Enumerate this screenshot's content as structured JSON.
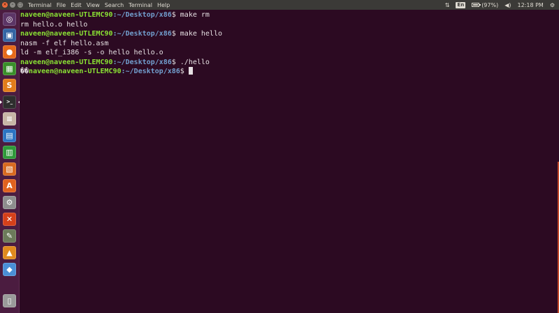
{
  "top_panel": {
    "menu": [
      "Terminal",
      "File",
      "Edit",
      "View",
      "Search",
      "Terminal",
      "Help"
    ],
    "network_icon": "network-updown-icon",
    "keyboard_layout": "En",
    "battery_percent": 97,
    "battery_text": "(97%)",
    "volume_icon": "speaker-icon",
    "clock": "12:18 PM",
    "power_icon": "gear-icon"
  },
  "launcher": {
    "items": [
      {
        "name": "dash",
        "glyph": "◎",
        "color": "#5c3566"
      },
      {
        "name": "files",
        "glyph": "▣",
        "color": "#3465a4"
      },
      {
        "name": "firefox",
        "glyph": "●",
        "color": "#e66a1a"
      },
      {
        "name": "software",
        "glyph": "▦",
        "color": "#3a8f2a"
      },
      {
        "name": "sublime",
        "glyph": "S",
        "color": "#e17d1b"
      },
      {
        "name": "terminal",
        "glyph": ">_",
        "color": "#2e2e2e"
      },
      {
        "name": "storage",
        "glyph": "≡",
        "color": "#c8b6a6"
      },
      {
        "name": "writer",
        "glyph": "▤",
        "color": "#2c74c3"
      },
      {
        "name": "calc",
        "glyph": "▥",
        "color": "#2f9a3a"
      },
      {
        "name": "impress",
        "glyph": "▧",
        "color": "#d86a20"
      },
      {
        "name": "software-center",
        "glyph": "A",
        "color": "#e0621f"
      },
      {
        "name": "settings",
        "glyph": "⚙",
        "color": "#8e8e8e"
      },
      {
        "name": "crossover",
        "glyph": "✕",
        "color": "#d5401a"
      },
      {
        "name": "notes",
        "glyph": "✎",
        "color": "#6c7a5a"
      },
      {
        "name": "vlc",
        "glyph": "▲",
        "color": "#e08a1e"
      },
      {
        "name": "package",
        "glyph": "◆",
        "color": "#4a8fd6"
      },
      {
        "name": "trash",
        "glyph": "▯",
        "color": "#9a9a9a"
      }
    ]
  },
  "terminal": {
    "lines": [
      {
        "user": "naveen@naveen-UTLEMC90",
        "path": ":~/Desktop/x86",
        "cmd": "$ make rm"
      },
      {
        "text": "rm hello.o hello"
      },
      {
        "user": "naveen@naveen-UTLEMC90",
        "path": ":~/Desktop/x86",
        "cmd": "$ make hello"
      },
      {
        "text": "nasm -f elf hello.asm"
      },
      {
        "text": "ld -m elf_i386 -s -o hello hello.o"
      },
      {
        "user": "naveen@naveen-UTLEMC90",
        "path": ":~/Desktop/x86",
        "cmd": "$ ./hello"
      },
      {
        "prefix": "��",
        "user": "naveen@naveen-UTLEMC90",
        "path": ":~/Desktop/x86",
        "cmd": "$ "
      }
    ]
  },
  "colors": {
    "terminal_bg": "#2c0a22",
    "prompt_user": "#8ae234",
    "prompt_path": "#729fcf",
    "panel_bg": "#3b3a37",
    "launcher_bg": "#4b1c40"
  }
}
